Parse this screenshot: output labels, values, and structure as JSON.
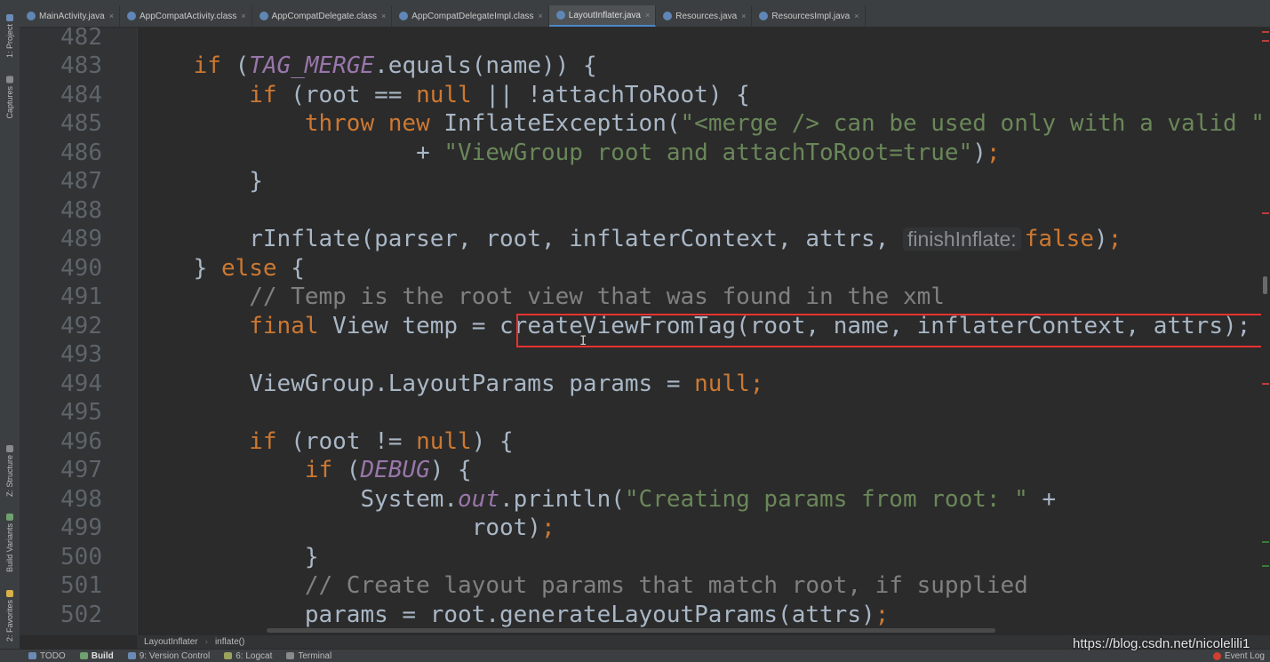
{
  "tabs": [
    {
      "label": "MainActivity.java",
      "icon_color": "#5f87b5"
    },
    {
      "label": "AppCompatActivity.class",
      "icon_color": "#5f87b5"
    },
    {
      "label": "AppCompatDelegate.class",
      "icon_color": "#5f87b5"
    },
    {
      "label": "AppCompatDelegateImpl.class",
      "icon_color": "#5f87b5"
    },
    {
      "label": "LayoutInflater.java",
      "icon_color": "#5f87b5",
      "active": true
    },
    {
      "label": "Resources.java",
      "icon_color": "#5f87b5"
    },
    {
      "label": "ResourcesImpl.java",
      "icon_color": "#5f87b5"
    }
  ],
  "tab_close_glyph": "×",
  "left_toolbar": [
    {
      "label": "1: Project",
      "icon": "project-icon"
    },
    {
      "label": "Captures",
      "icon": "captures-icon"
    },
    {
      "label": "Z: Structure",
      "icon": "structure-icon"
    },
    {
      "label": "Build Variants",
      "icon": "build-variants-icon"
    },
    {
      "label": "2: Favorites",
      "icon": "favorites-star-icon"
    }
  ],
  "line_numbers": [
    "482",
    "483",
    "484",
    "485",
    "486",
    "487",
    "488",
    "489",
    "490",
    "491",
    "492",
    "493",
    "494",
    "495",
    "496",
    "497",
    "498",
    "499",
    "500",
    "501",
    "502"
  ],
  "code_tokens": {
    "l483": {
      "indent": "    ",
      "if": "if",
      "p1": " (",
      "tag_merge": "TAG_MERGE",
      "p2": ".equals(name)) {"
    },
    "l484": {
      "indent": "        ",
      "if": "if",
      "p1": " (root == ",
      "null": "null",
      "p2": " || !attachToRoot) {"
    },
    "l485": {
      "indent": "            ",
      "throw": "throw",
      "sp1": " ",
      "new": "new",
      "p1": " InflateException(",
      "s1": "\"<merge /> can be used only with a valid \""
    },
    "l486": {
      "indent": "                    + ",
      "s1": "\"ViewGroup root and attachToRoot=true\"",
      "p1": ")",
      "semi": ";"
    },
    "l487": {
      "indent": "        ",
      "p1": "}"
    },
    "l489": {
      "indent": "        ",
      "p1": "rInflate(parser, root, inflaterContext, attrs, ",
      "hint": "finishInflate:",
      "false": "false",
      "p2": ")",
      "semi": ";"
    },
    "l490": {
      "indent": "    ",
      "p1": "} ",
      "else": "else",
      "p2": " {"
    },
    "l491": {
      "indent": "        ",
      "cmt": "// Temp is the root view that was found in the xml"
    },
    "l492": {
      "indent": "        ",
      "final": "final",
      "p1": " View temp = ",
      "p2": "createViewFromTag(root, name, inflaterContext, attrs);"
    },
    "l494": {
      "indent": "        ",
      "p1": "ViewGroup.LayoutParams params = ",
      "null": "null",
      "semi": ";"
    },
    "l496": {
      "indent": "        ",
      "if": "if",
      "p1": " (root != ",
      "null": "null",
      "p2": ") {"
    },
    "l497": {
      "indent": "            ",
      "if": "if",
      "p1": " (",
      "debug": "DEBUG",
      "p2": ") {"
    },
    "l498": {
      "indent": "                ",
      "p1": "System.",
      "out": "out",
      "p2": ".println(",
      "s1": "\"Creating params from root: \"",
      "p3": " +"
    },
    "l499": {
      "indent": "                        ",
      "p1": "root)",
      "semi": ";"
    },
    "l500": {
      "indent": "            ",
      "p1": "}"
    },
    "l501": {
      "indent": "            ",
      "cmt": "// Create layout params that match root, if supplied"
    },
    "l502": {
      "indent": "            ",
      "p1": "params = root.generateLayoutParams(attrs)",
      "semi": ";"
    }
  },
  "breadcrumb": {
    "file": "LayoutInflater",
    "sep": "›",
    "method": "inflate()"
  },
  "bottom_bar": [
    {
      "label": "TODO",
      "icon": "todo-icon",
      "color": "#6a8bb5"
    },
    {
      "label": "Build",
      "icon": "build-hammer-icon",
      "color": "#6fa06f",
      "active": true
    },
    {
      "label": "9: Version Control",
      "icon": "version-control-icon",
      "color": "#6a8bb5"
    },
    {
      "label": "6: Logcat",
      "icon": "logcat-icon",
      "color": "#9aa35a"
    },
    {
      "label": "Terminal",
      "icon": "terminal-icon",
      "color": "#8a8a8a"
    }
  ],
  "event_log": "Event Log",
  "watermark": "https://blog.csdn.net/nicolelili1",
  "colors": {
    "background": "#2b2b2b",
    "keyword": "#cc7832",
    "string": "#6a8759",
    "comment": "#808080",
    "constant": "#9876aa",
    "highlight": "#e8322f"
  }
}
